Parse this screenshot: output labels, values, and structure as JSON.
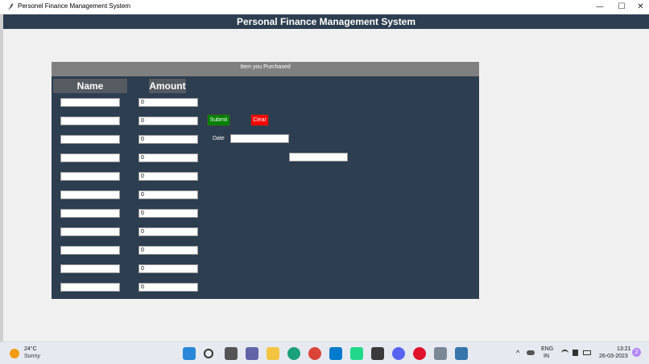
{
  "window": {
    "title": "Personel Finance Management System",
    "minimize_glyph": "—",
    "maximize_glyph": "☐",
    "close_glyph": "✕"
  },
  "header": {
    "title": "Personal Finance Management System"
  },
  "panel": {
    "heading": "Item you Purchased",
    "name_header": "Name",
    "amount_header": "Amount",
    "rows": [
      {
        "name": "",
        "amount": "0"
      },
      {
        "name": "",
        "amount": "0"
      },
      {
        "name": "",
        "amount": "0"
      },
      {
        "name": "",
        "amount": "0"
      },
      {
        "name": "",
        "amount": "0"
      },
      {
        "name": "",
        "amount": "0"
      },
      {
        "name": "",
        "amount": "0"
      },
      {
        "name": "",
        "amount": "0"
      },
      {
        "name": "",
        "amount": "0"
      },
      {
        "name": "",
        "amount": "0"
      },
      {
        "name": "",
        "amount": "0"
      }
    ],
    "submit_label": "Submit",
    "clear_label": "Clear",
    "date_label": "Date",
    "date_value": "",
    "result_value": ""
  },
  "taskbar": {
    "weather_temp": "24°C",
    "weather_desc": "Sunny",
    "icons": [
      "windows-start-icon",
      "search-icon",
      "task-view-icon",
      "teams-icon",
      "file-explorer-icon",
      "edge-icon",
      "chrome-icon",
      "vscode-icon",
      "pycharm-icon",
      "store-icon",
      "discord-icon",
      "opera-icon",
      "photos-icon",
      "python-icon"
    ],
    "tray_chevron": "^",
    "lang_line1": "ENG",
    "lang_line2": "IN",
    "time": "13:21",
    "date": "26-03-2023",
    "notification_count": "2"
  },
  "colors": {
    "header_bg": "#2c3e50",
    "panel_bg": "#2c3e50",
    "panel_head_bg": "#808080",
    "submit_bg": "#008000",
    "clear_bg": "#ff0000"
  }
}
